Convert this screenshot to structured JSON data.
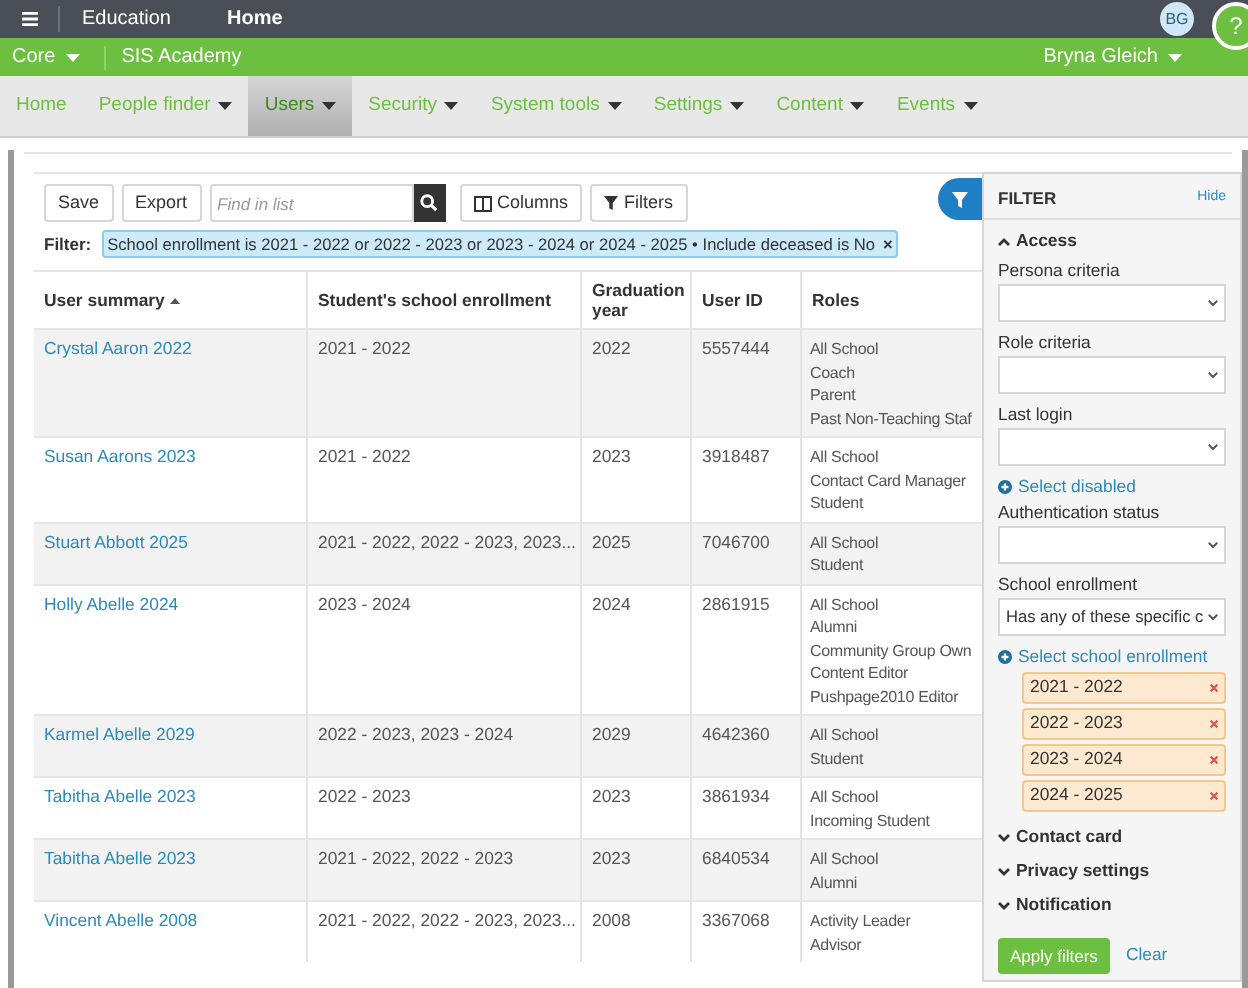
{
  "top_bar": {
    "title": "Education",
    "link": "Home",
    "avatar": "BG",
    "help": "?"
  },
  "context_bar": {
    "org": "Core",
    "school": "SIS Academy",
    "user": "Bryna Gleich"
  },
  "nav": [
    {
      "label": "Home",
      "has_menu": false,
      "selected": false
    },
    {
      "label": "People finder",
      "has_menu": true,
      "selected": false
    },
    {
      "label": "Users",
      "has_menu": true,
      "selected": true
    },
    {
      "label": "Security",
      "has_menu": true,
      "selected": false
    },
    {
      "label": "System tools",
      "has_menu": true,
      "selected": false
    },
    {
      "label": "Settings",
      "has_menu": true,
      "selected": false
    },
    {
      "label": "Content",
      "has_menu": true,
      "selected": false
    },
    {
      "label": "Events",
      "has_menu": true,
      "selected": false
    }
  ],
  "toolbar": {
    "save": "Save",
    "export": "Export",
    "search": {
      "placeholder": "Find in list"
    },
    "columns": "Columns",
    "filters": "Filters"
  },
  "filter": {
    "label": "Filter:",
    "chip": "School enrollment is 2021 - 2022 or 2022 - 2023 or 2023 - 2024 or 2024 - 2025 • Include deceased is No",
    "remove": "×"
  },
  "table": {
    "columns": [
      {
        "label": "User summary",
        "sorted": true
      },
      {
        "label": "Student's school enrollment",
        "sorted": false
      },
      {
        "label": "Graduation year",
        "sorted": false
      },
      {
        "label": "User ID",
        "sorted": false
      },
      {
        "label": "Roles",
        "sorted": false
      }
    ],
    "rows": [
      {
        "name": "Crystal Aaron 2022",
        "enrollment": "2021 - 2022",
        "year": "2022",
        "id": "5557444",
        "roles": [
          "All School",
          "Coach",
          "Parent",
          "Past Non-Teaching Staf"
        ]
      },
      {
        "name": "Susan Aarons 2023",
        "enrollment": "2021 - 2022",
        "year": "2023",
        "id": "3918487",
        "roles": [
          "All School",
          "Contact Card Manager",
          "Student"
        ]
      },
      {
        "name": "Stuart Abbott 2025",
        "enrollment": "2021 - 2022, 2022 - 2023, 2023...",
        "year": "2025",
        "id": "7046700",
        "roles": [
          "All School",
          "Student"
        ]
      },
      {
        "name": "Holly Abelle 2024",
        "enrollment": "2023 - 2024",
        "year": "2024",
        "id": "2861915",
        "roles": [
          "All School",
          "Alumni",
          "Community Group Own",
          "Content Editor",
          "Pushpage2010 Editor"
        ]
      },
      {
        "name": "Karmel Abelle 2029",
        "enrollment": "2022 - 2023, 2023 - 2024",
        "year": "2029",
        "id": "4642360",
        "roles": [
          "All School",
          "Student"
        ]
      },
      {
        "name": "Tabitha Abelle 2023",
        "enrollment": "2022 - 2023",
        "year": "2023",
        "id": "3861934",
        "roles": [
          "All School",
          "Incoming Student"
        ]
      },
      {
        "name": "Tabitha Abelle 2023",
        "enrollment": "2021 - 2022, 2022 - 2023",
        "year": "2023",
        "id": "6840534",
        "roles": [
          "All School",
          "Alumni"
        ]
      },
      {
        "name": "Vincent Abelle 2008",
        "enrollment": "2021 - 2022, 2022 - 2023, 2023...",
        "year": "2008",
        "id": "3367068",
        "roles": [
          "Activity Leader",
          "Advisor"
        ]
      }
    ]
  },
  "filter_panel": {
    "title": "FILTER",
    "hide": "Hide",
    "sections": [
      {
        "title": "Access",
        "expanded": true,
        "items": [
          {
            "kind": "select",
            "label": "Persona criteria",
            "value": ""
          },
          {
            "kind": "select",
            "label": "Role criteria",
            "value": ""
          },
          {
            "kind": "select",
            "label": "Last login",
            "value": ""
          },
          {
            "kind": "link",
            "label": "Select disabled"
          },
          {
            "kind": "select",
            "label": "Authentication status",
            "value": ""
          },
          {
            "kind": "select",
            "label": "School enrollment",
            "value": "Has any of these specific c"
          },
          {
            "kind": "link",
            "label": "Select school enrollment"
          },
          {
            "kind": "tags",
            "tags": [
              "2021 - 2022",
              "2022 - 2023",
              "2023 - 2024",
              "2024 - 2025"
            ]
          }
        ]
      },
      {
        "title": "Contact card",
        "expanded": false
      },
      {
        "title": "Privacy settings",
        "expanded": false
      },
      {
        "title": "Notification",
        "expanded": false
      }
    ],
    "apply": "Apply filters",
    "clear": "Clear"
  }
}
